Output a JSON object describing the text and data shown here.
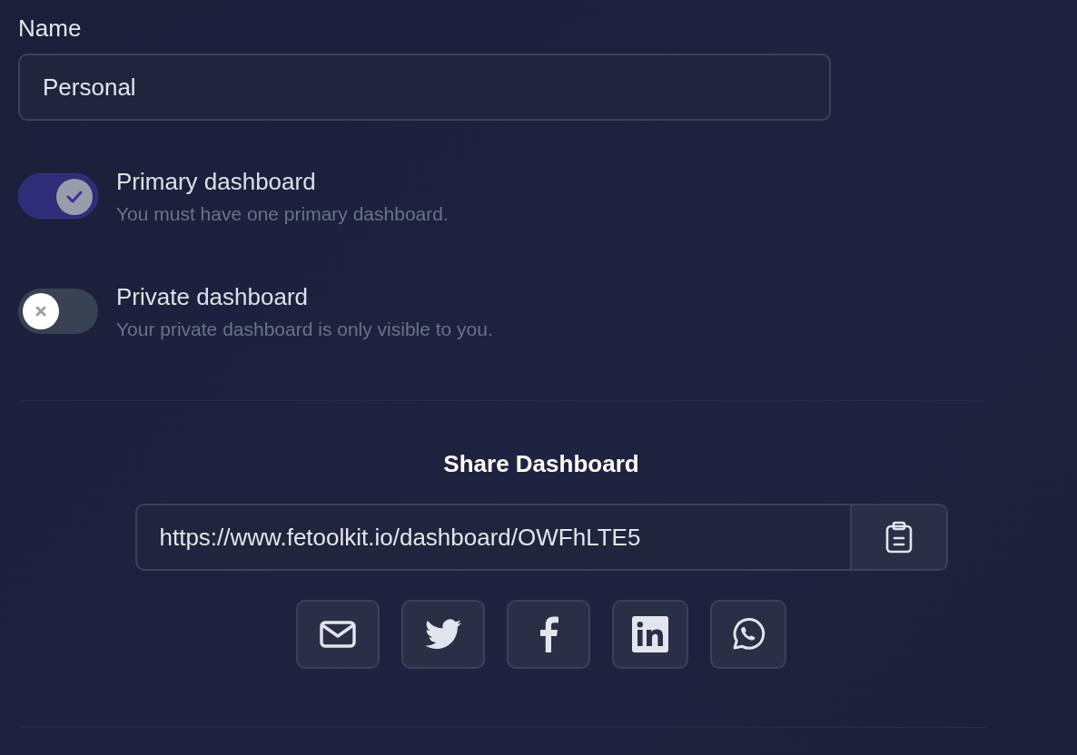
{
  "name_field": {
    "label": "Name",
    "value": "Personal"
  },
  "toggles": [
    {
      "title": "Primary dashboard",
      "description": "You must have one primary dashboard.",
      "on": true
    },
    {
      "title": "Private dashboard",
      "description": "Your private dashboard is only visible to you.",
      "on": false
    }
  ],
  "share": {
    "title": "Share Dashboard",
    "url": "https://www.fetoolkit.io/dashboard/OWFhLTE5",
    "buttons": [
      {
        "kind": "email"
      },
      {
        "kind": "twitter"
      },
      {
        "kind": "facebook"
      },
      {
        "kind": "linkedin"
      },
      {
        "kind": "whatsapp"
      }
    ]
  }
}
